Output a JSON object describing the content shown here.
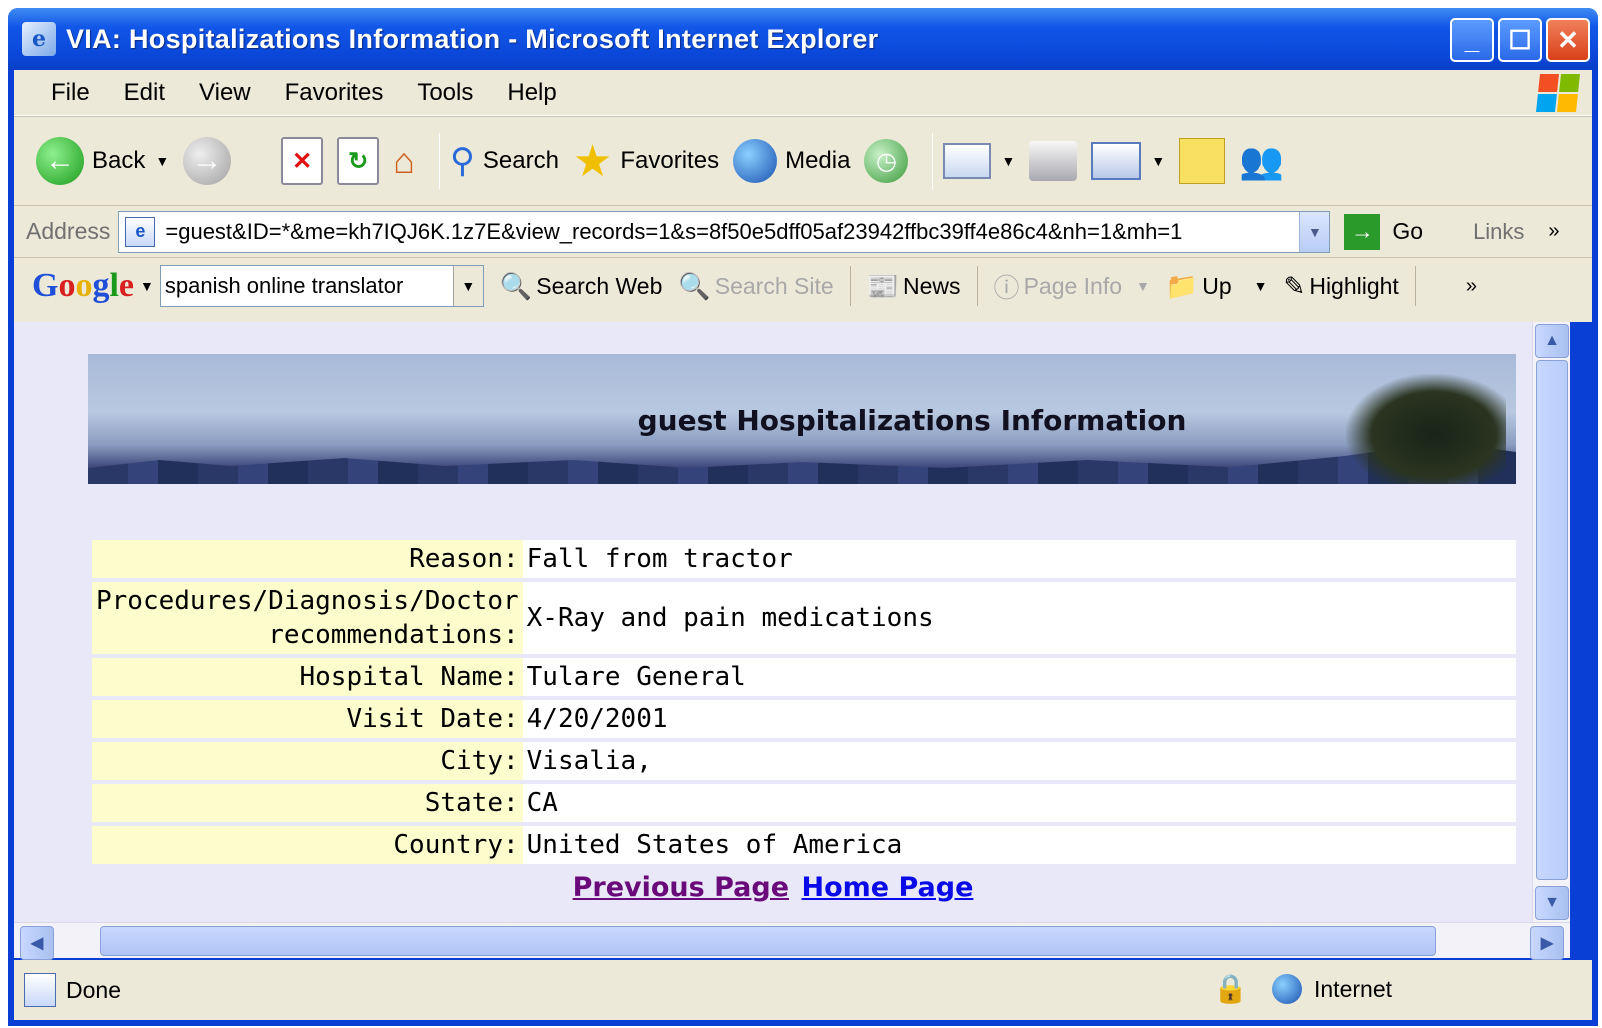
{
  "window": {
    "title": "VIA: Hospitalizations Information - Microsoft Internet Explorer",
    "app_icon": "ie-page-icon",
    "controls": [
      "minimize-icon",
      "maximize-icon",
      "close-icon"
    ]
  },
  "menubar": {
    "items": [
      {
        "label": "File"
      },
      {
        "label": "Edit"
      },
      {
        "label": "View"
      },
      {
        "label": "Favorites"
      },
      {
        "label": "Tools"
      },
      {
        "label": "Help"
      }
    ]
  },
  "toolbar": {
    "back": "Back",
    "search": "Search",
    "favorites": "Favorites",
    "media": "Media"
  },
  "address": {
    "label": "Address",
    "url": "=guest&ID=*&me=kh7IQJ6K.1z7E&view_records=1&s=8f50e5dff05af23942ffbc39ff4e86c4&nh=1&mh=1",
    "go": "Go",
    "links": "Links"
  },
  "googlebar": {
    "query": "spanish online translator",
    "search_web": "Search Web",
    "search_site": "Search Site",
    "news": "News",
    "page_info": "Page Info",
    "up": "Up",
    "highlight": "Highlight"
  },
  "page": {
    "banner_title": "guest Hospitalizations Information",
    "fields": [
      {
        "label": "Reason:",
        "value": "Fall from tractor"
      },
      {
        "label": "Procedures/Diagnosis/Doctor recommendations:",
        "value": "X-Ray and pain medications"
      },
      {
        "label": "Hospital Name:",
        "value": "Tulare General"
      },
      {
        "label": "Visit Date:",
        "value": "4/20/2001"
      },
      {
        "label": "City:",
        "value": "Visalia,"
      },
      {
        "label": "State:",
        "value": "CA"
      },
      {
        "label": "Country:",
        "value": "United States of America"
      }
    ],
    "previous_page": "Previous Page",
    "home_page": "Home Page"
  },
  "status": {
    "text": "Done",
    "zone": "Internet"
  },
  "colors": {
    "titlebar": "#0a46d8",
    "label_bg": "#fcfccc",
    "visited_link": "#6a0a7a",
    "link": "#0a0ae8"
  }
}
